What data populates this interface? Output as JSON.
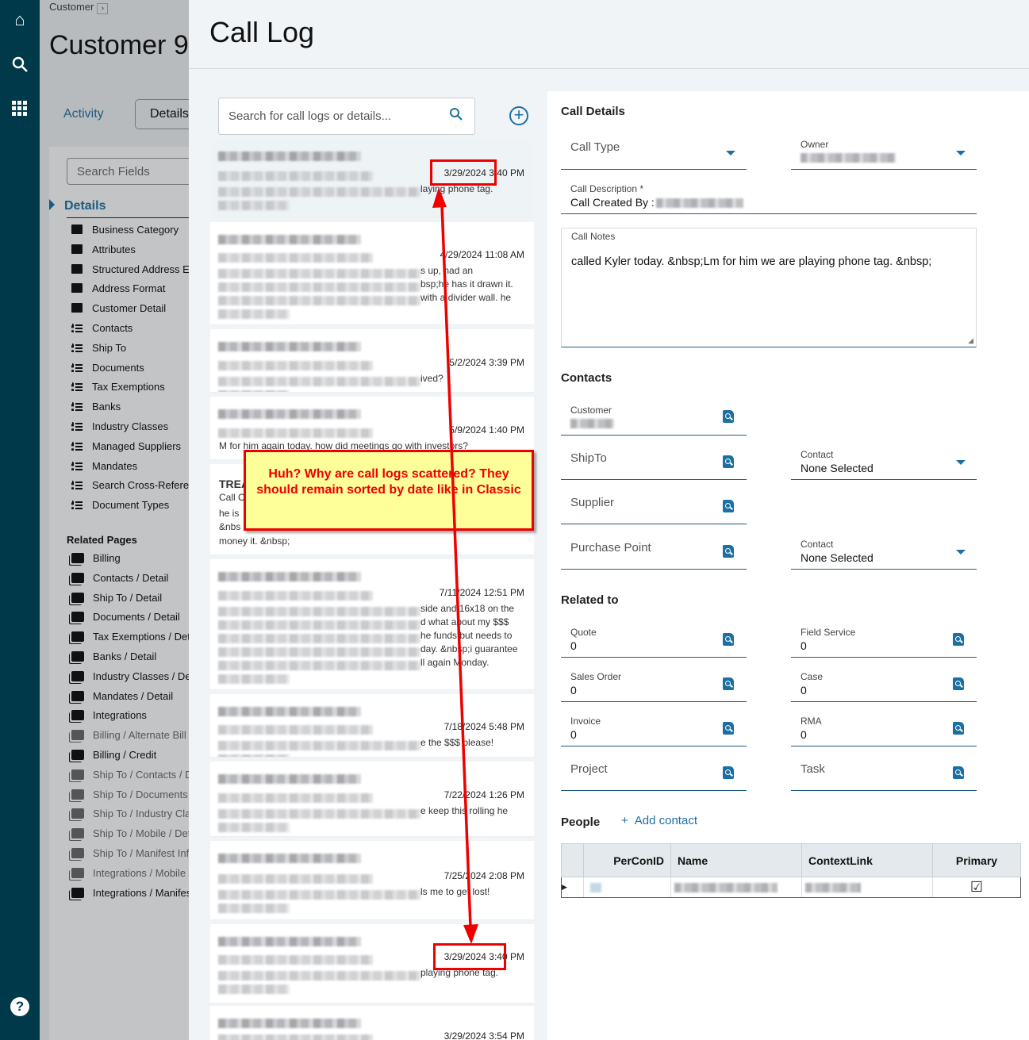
{
  "nav": {
    "icons": [
      "home-icon",
      "search-icon",
      "apps-grid-icon",
      "help-icon"
    ]
  },
  "background_page": {
    "breadcrumb": "Customer",
    "title": "Customer 9",
    "tabs": [
      "Activity",
      "Details"
    ],
    "search_fields_placeholder": "Search Fields",
    "details_heading": "Details",
    "details_items": [
      {
        "label": "Business Category",
        "icon": "card"
      },
      {
        "label": "Attributes",
        "icon": "card"
      },
      {
        "label": "Structured Address El",
        "icon": "card"
      },
      {
        "label": "Address Format",
        "icon": "card"
      },
      {
        "label": "Customer Detail",
        "icon": "card"
      },
      {
        "label": "Contacts",
        "icon": "list"
      },
      {
        "label": "Ship To",
        "icon": "list"
      },
      {
        "label": "Documents",
        "icon": "list"
      },
      {
        "label": "Tax Exemptions",
        "icon": "list"
      },
      {
        "label": "Banks",
        "icon": "list"
      },
      {
        "label": "Industry Classes",
        "icon": "list"
      },
      {
        "label": "Managed Suppliers",
        "icon": "list"
      },
      {
        "label": "Mandates",
        "icon": "list"
      },
      {
        "label": "Search Cross-Referenc",
        "icon": "list"
      },
      {
        "label": "Document Types",
        "icon": "list"
      }
    ],
    "related_heading": "Related Pages",
    "related_items": [
      {
        "label": "Billing",
        "enabled": true
      },
      {
        "label": "Contacts / Detail",
        "enabled": true
      },
      {
        "label": "Ship To / Detail",
        "enabled": true
      },
      {
        "label": "Documents / Detail",
        "enabled": true
      },
      {
        "label": "Tax Exemptions / Deta",
        "enabled": true
      },
      {
        "label": "Banks / Detail",
        "enabled": true
      },
      {
        "label": "Industry Classes / Det",
        "enabled": true
      },
      {
        "label": "Mandates / Detail",
        "enabled": true
      },
      {
        "label": "Integrations",
        "enabled": true
      },
      {
        "label": "Billing / Alternate Bill",
        "enabled": false
      },
      {
        "label": "Billing / Credit",
        "enabled": true
      },
      {
        "label": "Ship To / Contacts / De",
        "enabled": false
      },
      {
        "label": "Ship To / Documents /",
        "enabled": false
      },
      {
        "label": "Ship To / Industry Clas",
        "enabled": false
      },
      {
        "label": "Ship To / Mobile / Deta",
        "enabled": false
      },
      {
        "label": "Ship To / Manifest Info",
        "enabled": false
      },
      {
        "label": "Integrations / Mobile /",
        "enabled": false
      },
      {
        "label": "Integrations / Manifes",
        "enabled": true
      }
    ]
  },
  "modal": {
    "title": "Call Log",
    "search_placeholder": "Search for call logs or details...",
    "call_logs": [
      {
        "date": "3/29/2024 3:40 PM",
        "fragments": [
          "laying phone tag."
        ],
        "selected": true
      },
      {
        "date": "4/29/2024 11:08 AM",
        "fragments": [
          "s up, had an",
          "bsp;he has it drawn it.",
          "with a divider wall. he"
        ]
      },
      {
        "date": "5/2/2024 3:39 PM",
        "fragments": [
          "ived?"
        ]
      },
      {
        "date": "5/9/2024 1:40 PM",
        "fragments": [
          "M for him again today. how did meetings go with investors?"
        ]
      },
      {
        "date": "",
        "fragments": [
          "TREA",
          "Call C",
          "he is",
          "&nbs",
          "money it. &nbsp;"
        ]
      },
      {
        "date": "7/11/2024 12:51 PM",
        "fragments": [
          "side and 16x18 on the",
          "d what about my $$$",
          "he funds but needs to",
          "day. &nbsp;i guarantee",
          "ll again Monday."
        ]
      },
      {
        "date": "7/18/2024 5:48 PM",
        "fragments": [
          "e the $$$ please!"
        ]
      },
      {
        "date": "7/22/2024 1:26 PM",
        "fragments": [
          "e keep this rolling he"
        ]
      },
      {
        "date": "7/25/2024 2:08 PM",
        "fragments": [
          "ls me to get lost!"
        ]
      },
      {
        "date": "3/29/2024 3:40 PM",
        "fragments": [
          "playing phone tag."
        ]
      },
      {
        "date": "3/29/2024 3:54 PM",
        "fragments": []
      }
    ],
    "details": {
      "call_details_heading": "Call Details",
      "call_type_label": "Call Type",
      "owner_label": "Owner",
      "call_description_label": "Call Description *",
      "call_description_value": "Call Created By :",
      "call_notes_label": "Call Notes",
      "call_notes_value": "called Kyler today. &nbsp;Lm for him we are playing phone tag. &nbsp;",
      "contacts_heading": "Contacts",
      "customer_label": "Customer",
      "shipto_label": "ShipTo",
      "supplier_label": "Supplier",
      "purchase_point_label": "Purchase Point",
      "contact_label": "Contact",
      "contact_value": "None Selected",
      "related_heading": "Related to",
      "related": [
        {
          "label": "Quote",
          "value": "0"
        },
        {
          "label": "Field Service",
          "value": "0"
        },
        {
          "label": "Sales Order",
          "value": "0"
        },
        {
          "label": "Case",
          "value": "0"
        },
        {
          "label": "Invoice",
          "value": "0"
        },
        {
          "label": "RMA",
          "value": "0"
        },
        {
          "label": "Project",
          "value": ""
        },
        {
          "label": "Task",
          "value": ""
        }
      ],
      "people_heading": "People",
      "add_contact": "Add contact",
      "people_columns": [
        "PerConID",
        "Name",
        "ContextLink",
        "Primary"
      ],
      "people_rows": [
        {
          "primary": true
        }
      ]
    }
  },
  "annotation": {
    "text": "Huh? Why are call logs scattered? They should remain sorted by date like in Classic",
    "color": "#ee0000",
    "fill": "#ffff99"
  }
}
